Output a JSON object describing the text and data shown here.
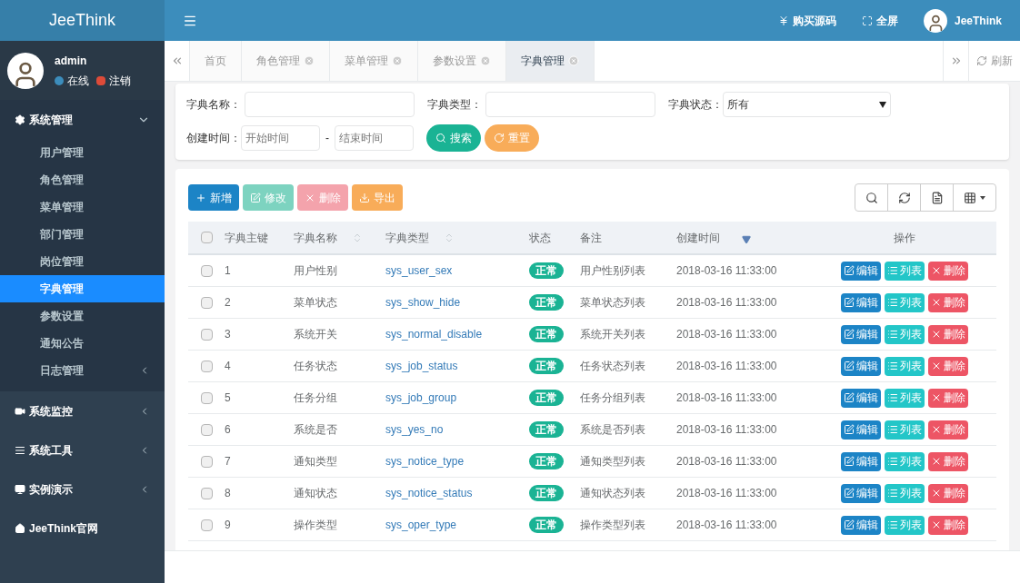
{
  "header": {
    "logo": "JeeThink",
    "actions": [
      {
        "kind": "yen",
        "label": "购买源码"
      },
      {
        "kind": "fullscreen",
        "label": "全屏"
      }
    ],
    "user": "JeeThink"
  },
  "sidebar": {
    "user": {
      "name": "admin",
      "status": "在线",
      "logout": "注销"
    },
    "menu": [
      {
        "label": "系统管理",
        "expanded": true,
        "children": [
          {
            "label": "用户管理",
            "selected": false,
            "has_children": false
          },
          {
            "label": "角色管理",
            "selected": false,
            "has_children": false
          },
          {
            "label": "菜单管理",
            "selected": false,
            "has_children": false
          },
          {
            "label": "部门管理",
            "selected": false,
            "has_children": false
          },
          {
            "label": "岗位管理",
            "selected": false,
            "has_children": false
          },
          {
            "label": "字典管理",
            "selected": true,
            "has_children": false
          },
          {
            "label": "参数设置",
            "selected": false,
            "has_children": false
          },
          {
            "label": "通知公告",
            "selected": false,
            "has_children": false
          },
          {
            "label": "日志管理",
            "selected": false,
            "has_children": true
          }
        ]
      },
      {
        "label": "系统监控",
        "expanded": false
      },
      {
        "label": "系统工具",
        "expanded": false
      },
      {
        "label": "实例演示",
        "expanded": false
      },
      {
        "label": "JeeThink官网",
        "link": true
      }
    ]
  },
  "tabs": [
    {
      "label": "首页",
      "selected": false,
      "closable": false
    },
    {
      "label": "角色管理",
      "selected": false,
      "closable": true
    },
    {
      "label": "菜单管理",
      "selected": false,
      "closable": true
    },
    {
      "label": "参数设置",
      "selected": false,
      "closable": true
    },
    {
      "label": "字典管理",
      "selected": true,
      "closable": true
    }
  ],
  "refresh": "刷新",
  "filters": {
    "name_label": "字典名称：",
    "type_label": "字典类型：",
    "status_label": "字典状态：",
    "status_value": "所有",
    "time_label": "创建时间：",
    "start_placeholder": "开始时间",
    "separator": "-",
    "end_placeholder": "结束时间",
    "search": "搜索",
    "reset": "重置"
  },
  "toolbar": [
    {
      "kind": "add",
      "label": "新增",
      "disabled": false
    },
    {
      "kind": "edit",
      "label": "修改",
      "disabled": true
    },
    {
      "kind": "delete",
      "label": "删除",
      "disabled": true
    },
    {
      "kind": "export",
      "label": "导出",
      "disabled": false
    }
  ],
  "table": {
    "all_checked": false,
    "columns": [
      {
        "label": "字典主键",
        "sortable": false,
        "sorted": false
      },
      {
        "label": "字典名称",
        "sortable": true,
        "sorted": false
      },
      {
        "label": "字典类型",
        "sortable": true,
        "sorted": false
      },
      {
        "label": "状态",
        "sortable": false,
        "sorted": false
      },
      {
        "label": "备注",
        "sortable": false,
        "sorted": false
      },
      {
        "label": "创建时间",
        "sortable": true,
        "sorted": true
      },
      {
        "label": "操作",
        "sortable": false,
        "sorted": false
      }
    ],
    "rows": [
      {
        "checked": false,
        "id": "1",
        "name": "用户性别",
        "type": "sys_user_sex",
        "status": "正常",
        "remark": "用户性别列表",
        "created": "2018-03-16 11:33:00",
        "actions": [
          "编辑",
          "列表",
          "删除"
        ]
      },
      {
        "checked": false,
        "id": "2",
        "name": "菜单状态",
        "type": "sys_show_hide",
        "status": "正常",
        "remark": "菜单状态列表",
        "created": "2018-03-16 11:33:00",
        "actions": [
          "编辑",
          "列表",
          "删除"
        ]
      },
      {
        "checked": false,
        "id": "3",
        "name": "系统开关",
        "type": "sys_normal_disable",
        "status": "正常",
        "remark": "系统开关列表",
        "created": "2018-03-16 11:33:00",
        "actions": [
          "编辑",
          "列表",
          "删除"
        ]
      },
      {
        "checked": false,
        "id": "4",
        "name": "任务状态",
        "type": "sys_job_status",
        "status": "正常",
        "remark": "任务状态列表",
        "created": "2018-03-16 11:33:00",
        "actions": [
          "编辑",
          "列表",
          "删除"
        ]
      },
      {
        "checked": false,
        "id": "5",
        "name": "任务分组",
        "type": "sys_job_group",
        "status": "正常",
        "remark": "任务分组列表",
        "created": "2018-03-16 11:33:00",
        "actions": [
          "编辑",
          "列表",
          "删除"
        ]
      },
      {
        "checked": false,
        "id": "6",
        "name": "系统是否",
        "type": "sys_yes_no",
        "status": "正常",
        "remark": "系统是否列表",
        "created": "2018-03-16 11:33:00",
        "actions": [
          "编辑",
          "列表",
          "删除"
        ]
      },
      {
        "checked": false,
        "id": "7",
        "name": "通知类型",
        "type": "sys_notice_type",
        "status": "正常",
        "remark": "通知类型列表",
        "created": "2018-03-16 11:33:00",
        "actions": [
          "编辑",
          "列表",
          "删除"
        ]
      },
      {
        "checked": false,
        "id": "8",
        "name": "通知状态",
        "type": "sys_notice_status",
        "status": "正常",
        "remark": "通知状态列表",
        "created": "2018-03-16 11:33:00",
        "actions": [
          "编辑",
          "列表",
          "删除"
        ]
      },
      {
        "checked": false,
        "id": "9",
        "name": "操作类型",
        "type": "sys_oper_type",
        "status": "正常",
        "remark": "操作类型列表",
        "created": "2018-03-16 11:33:00",
        "actions": [
          "编辑",
          "列表",
          "删除"
        ]
      }
    ]
  }
}
